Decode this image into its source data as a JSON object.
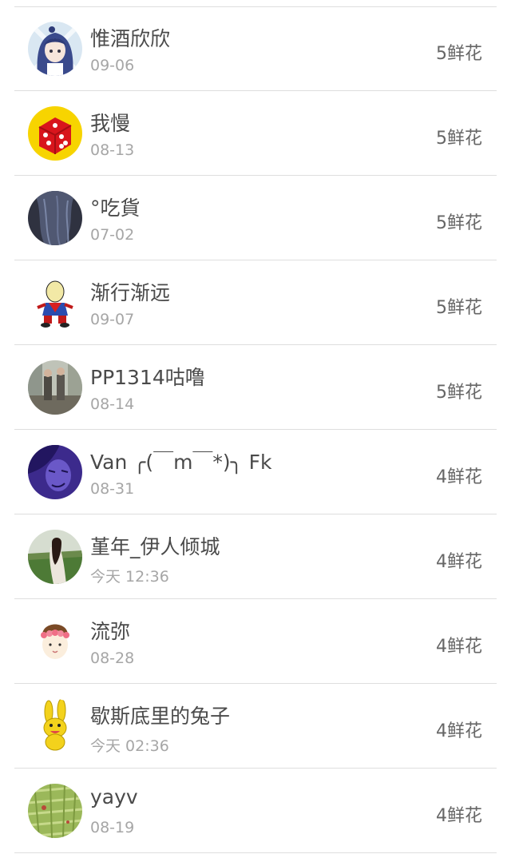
{
  "users": [
    {
      "name": "惟酒欣欣",
      "date": "09-06",
      "flowers": "5鲜花",
      "avatar": "anime-girl-avatar"
    },
    {
      "name": "我慢",
      "date": "08-13",
      "flowers": "5鲜花",
      "avatar": "red-dice-avatar"
    },
    {
      "name": "°吃貨",
      "date": "07-02",
      "flowers": "5鲜花",
      "avatar": "dark-hair-avatar"
    },
    {
      "name": "渐行渐远",
      "date": "09-07",
      "flowers": "5鲜花",
      "avatar": "cartoon-boy-avatar"
    },
    {
      "name": "PP1314咕噜",
      "date": "08-14",
      "flowers": "5鲜花",
      "avatar": "street-photo-avatar"
    },
    {
      "name": "Van ╭(￣m￣*)╮ Fk",
      "date": "08-31",
      "flowers": "4鲜花",
      "avatar": "purple-face-avatar"
    },
    {
      "name": "堇年_伊人倾城",
      "date": "今天 12:36",
      "flowers": "4鲜花",
      "avatar": "girl-field-avatar"
    },
    {
      "name": "流弥",
      "date": "08-28",
      "flowers": "4鲜花",
      "avatar": "flower-crown-girl-avatar"
    },
    {
      "name": "歇斯底里的兔子",
      "date": "今天 02:36",
      "flowers": "4鲜花",
      "avatar": "yellow-rabbit-avatar"
    },
    {
      "name": "yayv",
      "date": "08-19",
      "flowers": "4鲜花",
      "avatar": "green-grass-avatar"
    }
  ]
}
